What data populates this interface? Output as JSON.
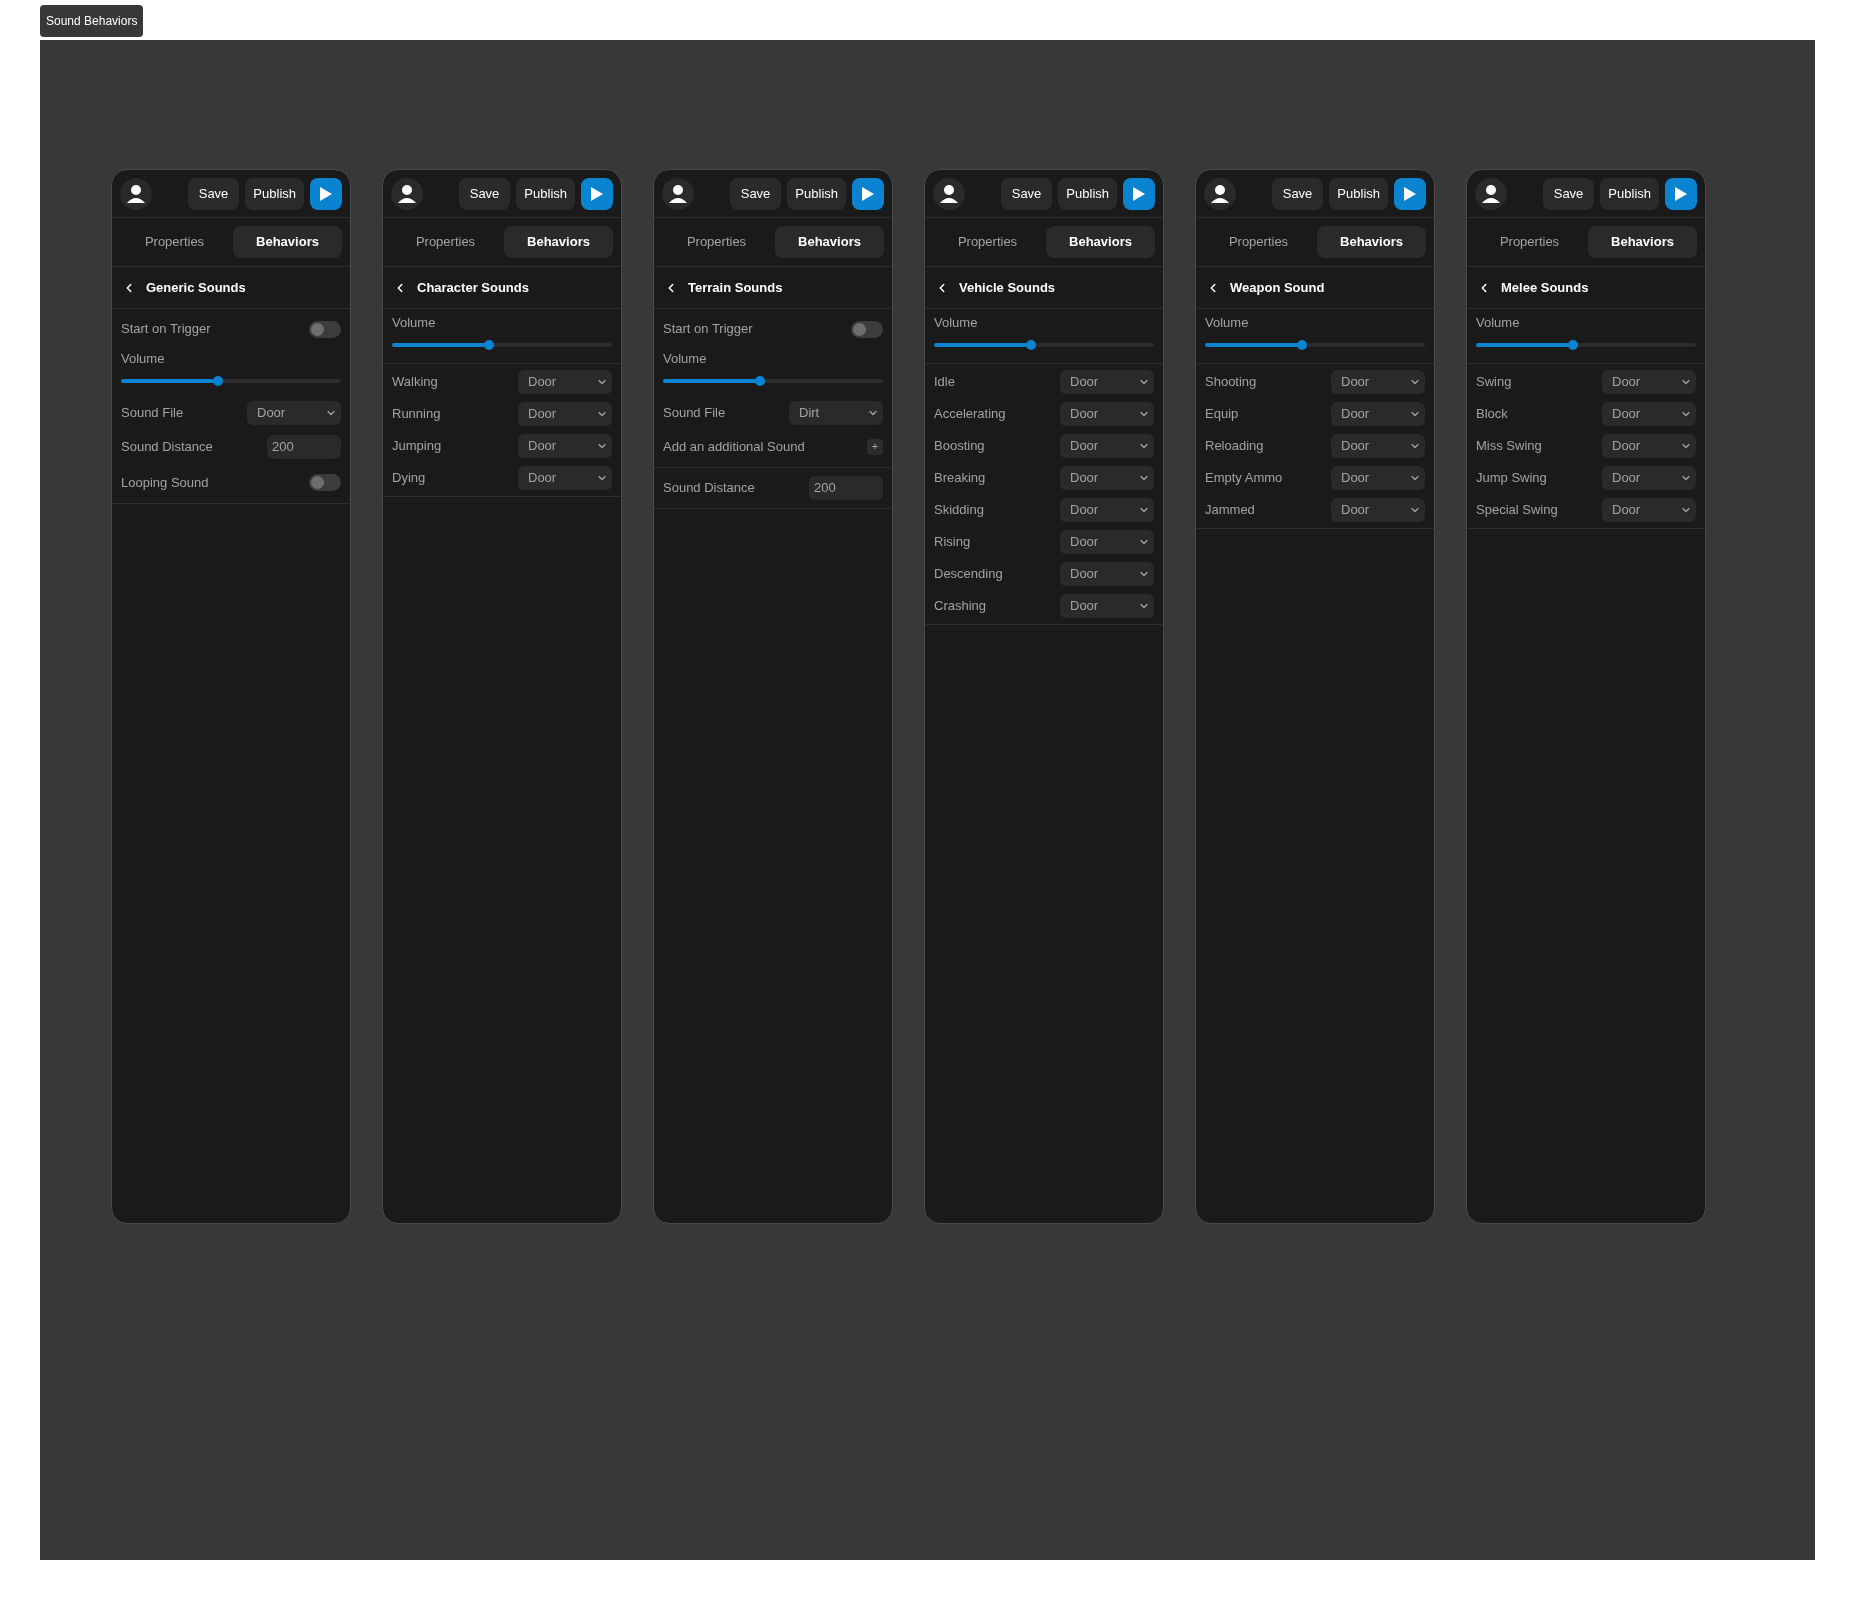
{
  "window": {
    "title": "Sound Behaviors"
  },
  "panels": [
    {
      "toolbar": {
        "save": "Save",
        "publish": "Publish"
      },
      "tabs": [
        {
          "label": "Properties",
          "selected": false
        },
        {
          "label": "Behaviors",
          "selected": true
        }
      ],
      "section": "Generic Sounds",
      "groups": [
        [
          {
            "kind": "toggle",
            "label": "Start on Trigger",
            "on": false
          },
          {
            "kind": "slider",
            "label": "Volume",
            "level": 0.44
          },
          {
            "kind": "select",
            "label": "Sound File",
            "value": "Door"
          },
          {
            "kind": "number",
            "label": "Sound Distance",
            "value": "200"
          },
          {
            "kind": "toggle",
            "label": "Looping Sound",
            "on": false
          }
        ]
      ]
    },
    {
      "toolbar": {
        "save": "Save",
        "publish": "Publish"
      },
      "tabs": [
        {
          "label": "Properties",
          "selected": false
        },
        {
          "label": "Behaviors",
          "selected": true
        }
      ],
      "section": "Character Sounds",
      "groups": [
        [
          {
            "kind": "slider",
            "label": "Volume",
            "level": 0.44
          }
        ],
        [
          {
            "kind": "select",
            "label": "Walking",
            "value": "Door"
          },
          {
            "kind": "select",
            "label": "Running",
            "value": "Door"
          },
          {
            "kind": "select",
            "label": "Jumping",
            "value": "Door"
          },
          {
            "kind": "select",
            "label": "Dying",
            "value": "Door"
          }
        ]
      ]
    },
    {
      "toolbar": {
        "save": "Save",
        "publish": "Publish"
      },
      "tabs": [
        {
          "label": "Properties",
          "selected": false
        },
        {
          "label": "Behaviors",
          "selected": true
        }
      ],
      "section": "Terrain Sounds",
      "groups": [
        [
          {
            "kind": "toggle",
            "label": "Start on Trigger",
            "on": false
          },
          {
            "kind": "slider",
            "label": "Volume",
            "level": 0.44
          },
          {
            "kind": "select",
            "label": "Sound File",
            "value": "Dirt"
          },
          {
            "kind": "add",
            "label": "Add an additional Sound",
            "button": "+"
          }
        ],
        [
          {
            "kind": "number",
            "label": "Sound Distance",
            "value": "200"
          }
        ]
      ]
    },
    {
      "toolbar": {
        "save": "Save",
        "publish": "Publish"
      },
      "tabs": [
        {
          "label": "Properties",
          "selected": false
        },
        {
          "label": "Behaviors",
          "selected": true
        }
      ],
      "section": "Vehicle Sounds",
      "groups": [
        [
          {
            "kind": "slider",
            "label": "Volume",
            "level": 0.44
          }
        ],
        [
          {
            "kind": "select",
            "label": "Idle",
            "value": "Door"
          },
          {
            "kind": "select",
            "label": "Accelerating",
            "value": "Door"
          },
          {
            "kind": "select",
            "label": "Boosting",
            "value": "Door"
          },
          {
            "kind": "select",
            "label": "Breaking",
            "value": "Door"
          },
          {
            "kind": "select",
            "label": "Skidding",
            "value": "Door"
          },
          {
            "kind": "select",
            "label": "Rising",
            "value": "Door"
          },
          {
            "kind": "select",
            "label": "Descending",
            "value": "Door"
          },
          {
            "kind": "select",
            "label": "Crashing",
            "value": "Door"
          }
        ]
      ]
    },
    {
      "toolbar": {
        "save": "Save",
        "publish": "Publish"
      },
      "tabs": [
        {
          "label": "Properties",
          "selected": false
        },
        {
          "label": "Behaviors",
          "selected": true
        }
      ],
      "section": "Weapon Sound",
      "groups": [
        [
          {
            "kind": "slider",
            "label": "Volume",
            "level": 0.44
          }
        ],
        [
          {
            "kind": "select",
            "label": "Shooting",
            "value": "Door"
          },
          {
            "kind": "select",
            "label": "Equip",
            "value": "Door"
          },
          {
            "kind": "select",
            "label": "Reloading",
            "value": "Door"
          },
          {
            "kind": "select",
            "label": "Empty Ammo",
            "value": "Door"
          },
          {
            "kind": "select",
            "label": "Jammed",
            "value": "Door"
          }
        ]
      ]
    },
    {
      "toolbar": {
        "save": "Save",
        "publish": "Publish"
      },
      "tabs": [
        {
          "label": "Properties",
          "selected": false
        },
        {
          "label": "Behaviors",
          "selected": true
        }
      ],
      "section": "Melee Sounds",
      "groups": [
        [
          {
            "kind": "slider",
            "label": "Volume",
            "level": 0.44
          }
        ],
        [
          {
            "kind": "select",
            "label": "Swing",
            "value": "Door"
          },
          {
            "kind": "select",
            "label": "Block",
            "value": "Door"
          },
          {
            "kind": "select",
            "label": "Miss Swing",
            "value": "Door"
          },
          {
            "kind": "select",
            "label": "Jump Swing",
            "value": "Door"
          },
          {
            "kind": "select",
            "label": "Special Swing",
            "value": "Door"
          }
        ]
      ]
    }
  ]
}
